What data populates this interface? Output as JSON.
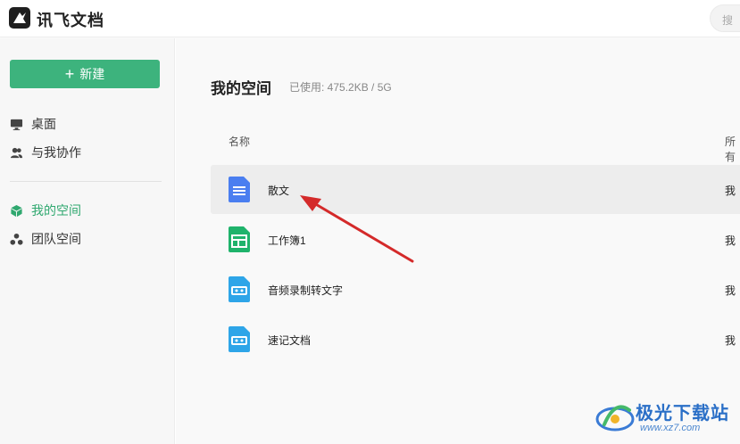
{
  "header": {
    "brand": "讯飞文档",
    "search_placeholder": "搜"
  },
  "sidebar": {
    "new_button": "新建",
    "items": [
      {
        "label": "桌面",
        "icon": "monitor-icon"
      },
      {
        "label": "与我协作",
        "icon": "people-icon"
      },
      {
        "label": "我的空间",
        "icon": "cube-icon",
        "active": true
      },
      {
        "label": "团队空间",
        "icon": "team-icon"
      }
    ]
  },
  "main": {
    "title": "我的空间",
    "usage": "已使用: 475.2KB  /  5G",
    "columns": {
      "name": "名称",
      "owner": "所有"
    },
    "files": [
      {
        "name": "散文",
        "owner": "我",
        "icon": "doc-icon"
      },
      {
        "name": "工作簿1",
        "owner": "我",
        "icon": "sheet-icon"
      },
      {
        "name": "音频录制转文字",
        "owner": "我",
        "icon": "audio-icon"
      },
      {
        "name": "速记文档",
        "owner": "我",
        "icon": "audio-icon"
      }
    ]
  },
  "watermark": {
    "title": "极光下载站",
    "url": "www.xz7.com"
  },
  "colors": {
    "accent": "#3db37d",
    "active_nav": "#2fa86f",
    "doc_blue": "#4a7ef0",
    "sheet_green": "#1fb36b",
    "audio_blue": "#2ea5e8",
    "arrow_red": "#d42a2a"
  }
}
